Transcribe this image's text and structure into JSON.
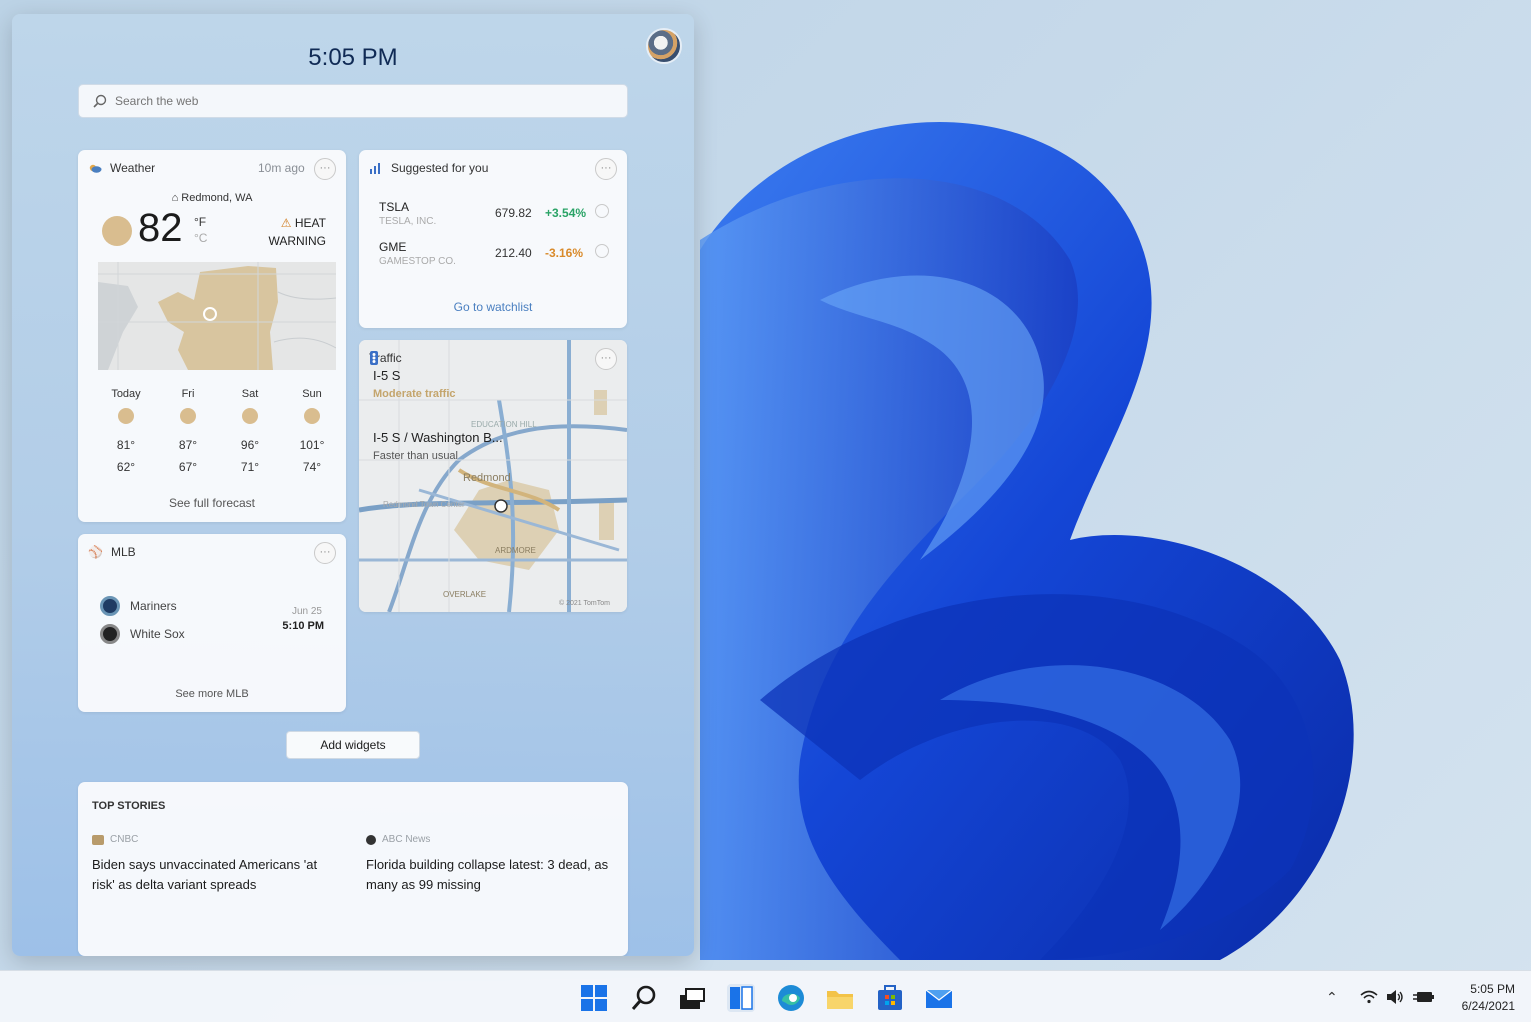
{
  "panel": {
    "time": "5:05 PM",
    "search_placeholder": "Search the web",
    "add_widgets": "Add widgets"
  },
  "weather": {
    "title": "Weather",
    "updated": "10m ago",
    "location": "Redmond, WA",
    "temp": "82",
    "unit_f": "°F",
    "unit_c": "°C",
    "warning_line1": "HEAT",
    "warning_line2": "WARNING",
    "forecast": [
      {
        "day": "Today",
        "hi": "81°",
        "lo": "62°"
      },
      {
        "day": "Fri",
        "hi": "87°",
        "lo": "67°"
      },
      {
        "day": "Sat",
        "hi": "96°",
        "lo": "71°"
      },
      {
        "day": "Sun",
        "hi": "101°",
        "lo": "74°"
      }
    ],
    "link": "See full forecast"
  },
  "suggested": {
    "title": "Suggested for you",
    "stocks": [
      {
        "symbol": "TSLA",
        "name": "TESLA, INC.",
        "price": "679.82",
        "change": "+3.54%",
        "color": "#2aa366"
      },
      {
        "symbol": "GME",
        "name": "GAMESTOP CO.",
        "price": "212.40",
        "change": "-3.16%",
        "color": "#d98a2a"
      }
    ],
    "link": "Go to watchlist"
  },
  "traffic": {
    "title": "Traffic",
    "route1": "I-5 S",
    "status1": "Moderate traffic",
    "route2": "I-5 S / Washington B...",
    "status2": "Faster than usual",
    "map_label_city": "Redmond",
    "map_label_hill": "EDUCATION HILL",
    "map_label_town": "Redmond Town Center",
    "map_label_overlake": "OVERLAKE",
    "map_label_ardmore": "ARDMORE",
    "copyright": "© 2021 TomTom"
  },
  "mlb": {
    "title": "MLB",
    "team1": "Mariners",
    "team2": "White Sox",
    "date": "Jun 25",
    "time": "5:10 PM",
    "link": "See more MLB"
  },
  "stories": {
    "title": "TOP STORIES",
    "items": [
      {
        "source": "CNBC",
        "headline": "Biden says unvaccinated Americans 'at risk' as delta variant spreads"
      },
      {
        "source": "ABC News",
        "headline": "Florida building collapse latest: 3 dead, as many as 99 missing"
      }
    ]
  },
  "taskbar": {
    "time": "5:05 PM",
    "date": "6/24/2021",
    "icons": [
      "windows-start-icon",
      "search-icon",
      "task-view-icon",
      "widgets-icon",
      "edge-icon",
      "file-explorer-icon",
      "store-icon",
      "mail-icon"
    ]
  },
  "colors": {
    "accent": "#0f5fd6",
    "wallpaper_blue": "#1a4fd8",
    "link": "#4a7fc0"
  }
}
